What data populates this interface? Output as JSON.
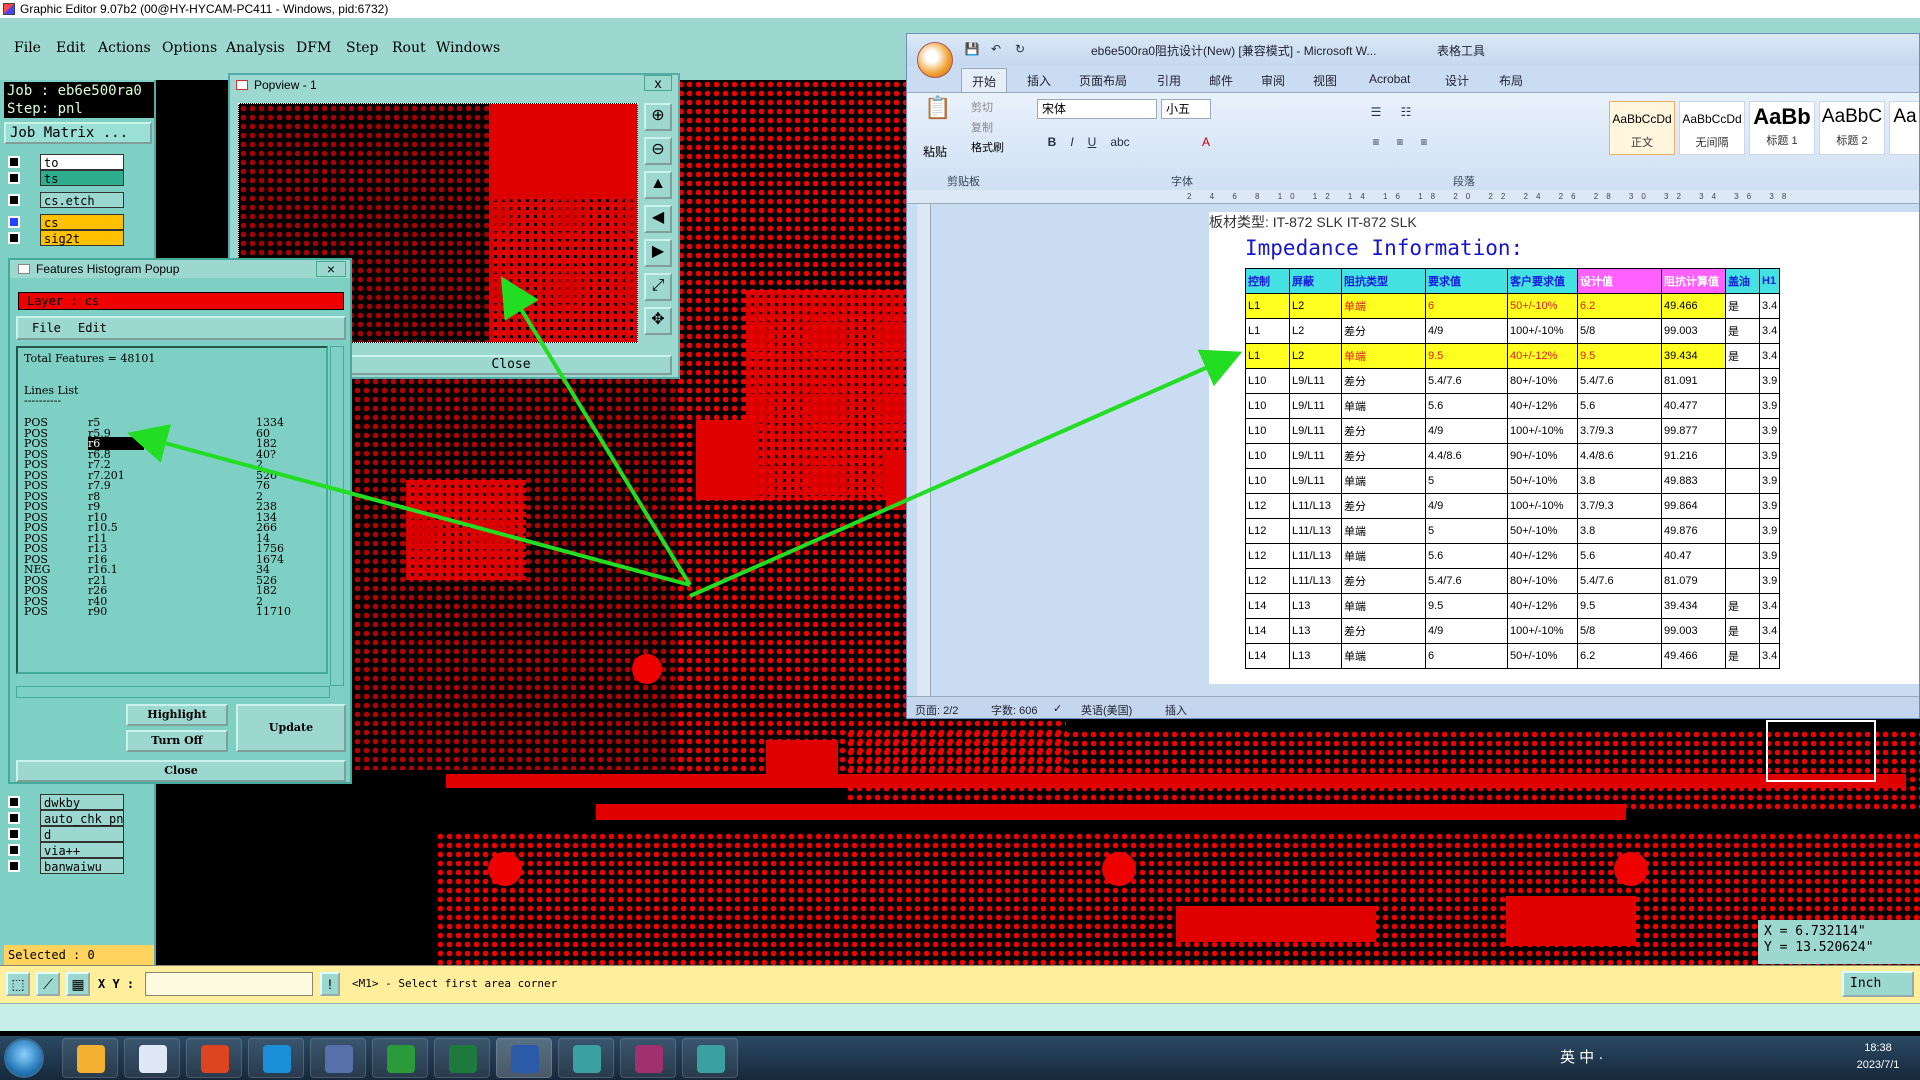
{
  "app_title": "Graphic Editor 9.07b2 (00@HY-HYCAM-PC411 - Windows, pid:6732)",
  "menu": [
    "File",
    "Edit",
    "Actions",
    "Options",
    "Analysis",
    "DFM",
    "Step",
    "Rout",
    "Windows"
  ],
  "left_panel": {
    "job": "Job : eb6e500ra0",
    "step": "Step: pnl",
    "job_matrix": "Job Matrix ...",
    "layers_top": [
      {
        "name": "to",
        "color": "#ffffff"
      },
      {
        "name": "ts",
        "color": "#2eae8e"
      },
      {
        "name": "cs.etch",
        "color": "#9cd8d0"
      },
      {
        "name": "cs",
        "color": "#ffc000"
      },
      {
        "name": "sig2t",
        "color": "#ffc000"
      }
    ],
    "layers_bottom": [
      "dwkby",
      "auto_chk_pn",
      "d",
      "via++",
      "banwaiwu"
    ],
    "selected": "Selected : 0"
  },
  "popview": {
    "title": "Popview - 1",
    "close": "Close",
    "close_x": "x"
  },
  "histogram": {
    "title": "Features Histogram Popup",
    "layer": "Layer : cs",
    "menu_file": "File",
    "menu_edit": "Edit",
    "total": "Total Features = 48101",
    "lines_list": "Lines List",
    "underline": "----------",
    "rows": [
      {
        "pol": "POS",
        "sym": "r5",
        "count": "1334"
      },
      {
        "pol": "POS",
        "sym": "r5.9",
        "count": "60"
      },
      {
        "pol": "POS",
        "sym": "r6",
        "count": "182"
      },
      {
        "pol": "POS",
        "sym": "r6.8",
        "count": "40?"
      },
      {
        "pol": "POS",
        "sym": "r7.2",
        "count": "2"
      },
      {
        "pol": "POS",
        "sym": "r7.201",
        "count": "526"
      },
      {
        "pol": "POS",
        "sym": "r7.9",
        "count": "76"
      },
      {
        "pol": "POS",
        "sym": "r8",
        "count": "2"
      },
      {
        "pol": "POS",
        "sym": "r9",
        "count": "238"
      },
      {
        "pol": "POS",
        "sym": "r10",
        "count": "134"
      },
      {
        "pol": "POS",
        "sym": "r10.5",
        "count": "266"
      },
      {
        "pol": "POS",
        "sym": "r11",
        "count": "14"
      },
      {
        "pol": "POS",
        "sym": "r13",
        "count": "1756"
      },
      {
        "pol": "POS",
        "sym": "r16",
        "count": "1674"
      },
      {
        "pol": "NEG",
        "sym": "r16.1",
        "count": "34"
      },
      {
        "pol": "POS",
        "sym": "r21",
        "count": "526"
      },
      {
        "pol": "POS",
        "sym": "r26",
        "count": "182"
      },
      {
        "pol": "POS",
        "sym": "r40",
        "count": "2"
      },
      {
        "pol": "POS",
        "sym": "r90",
        "count": "11710"
      }
    ],
    "highlighted_row": 2,
    "btn_highlight": "Highlight",
    "btn_turnoff": "Turn Off",
    "btn_update": "Update",
    "btn_close": "Close"
  },
  "word": {
    "title": "eb6e500ra0阻抗设计(New) [兼容模式] - Microsoft W...",
    "table_tools": "表格工具",
    "tabs": [
      "开始",
      "插入",
      "页面布局",
      "引用",
      "邮件",
      "审阅",
      "视图",
      "Acrobat",
      "设计",
      "布局"
    ],
    "clipboard": {
      "paste": "粘贴",
      "cut": "剪切",
      "copy": "复制",
      "format_painter": "格式刷",
      "label": "剪贴板"
    },
    "font": {
      "name": "宋体",
      "size": "小五",
      "label": "字体"
    },
    "paragraph_label": "段落",
    "styles": [
      {
        "preview": "AaBbCcDd",
        "name": "正文"
      },
      {
        "preview": "AaBbCcDd",
        "name": "无间隔"
      },
      {
        "preview": "AaBb",
        "name": "标题 1"
      },
      {
        "preview": "AaBbC",
        "name": "标题 2"
      },
      {
        "preview": "Aa",
        "name": ""
      }
    ],
    "doc_top": "板材类型:    IT-872 SLK         IT-872 SLK",
    "heading": "Impedance Information:",
    "table_headers": [
      "控制",
      "屏蔽",
      "阻抗类型",
      "要求值",
      "客户要求值",
      "设计值",
      "阻抗计算值",
      "盖油",
      "H1"
    ],
    "table_rows": [
      [
        "L1",
        "L2",
        "单端",
        "6",
        "50+/-10%",
        "6.2",
        "49.466",
        "是",
        "3.4"
      ],
      [
        "L1",
        "L2",
        "差分",
        "4/9",
        "100+/-10%",
        "5/8",
        "99.003",
        "是",
        "3.4"
      ],
      [
        "L1",
        "L2",
        "单端",
        "9.5",
        "40+/-12%",
        "9.5",
        "39.434",
        "是",
        "3.4"
      ],
      [
        "L10",
        "L9/L11",
        "差分",
        "5.4/7.6",
        "80+/-10%",
        "5.4/7.6",
        "81.091",
        "",
        "3.9"
      ],
      [
        "L10",
        "L9/L11",
        "单端",
        "5.6",
        "40+/-12%",
        "5.6",
        "40.477",
        "",
        "3.9"
      ],
      [
        "L10",
        "L9/L11",
        "差分",
        "4/9",
        "100+/-10%",
        "3.7/9.3",
        "99.877",
        "",
        "3.9"
      ],
      [
        "L10",
        "L9/L11",
        "差分",
        "4.4/8.6",
        "90+/-10%",
        "4.4/8.6",
        "91.216",
        "",
        "3.9"
      ],
      [
        "L10",
        "L9/L11",
        "单端",
        "5",
        "50+/-10%",
        "3.8",
        "49.883",
        "",
        "3.9"
      ],
      [
        "L12",
        "L11/L13",
        "差分",
        "4/9",
        "100+/-10%",
        "3.7/9.3",
        "99.864",
        "",
        "3.9"
      ],
      [
        "L12",
        "L11/L13",
        "单端",
        "5",
        "50+/-10%",
        "3.8",
        "49.876",
        "",
        "3.9"
      ],
      [
        "L12",
        "L11/L13",
        "单端",
        "5.6",
        "40+/-12%",
        "5.6",
        "40.47",
        "",
        "3.9"
      ],
      [
        "L12",
        "L11/L13",
        "差分",
        "5.4/7.6",
        "80+/-10%",
        "5.4/7.6",
        "81.079",
        "",
        "3.9"
      ],
      [
        "L14",
        "L13",
        "单端",
        "9.5",
        "40+/-12%",
        "9.5",
        "39.434",
        "是",
        "3.4"
      ],
      [
        "L14",
        "L13",
        "差分",
        "4/9",
        "100+/-10%",
        "5/8",
        "99.003",
        "是",
        "3.4"
      ],
      [
        "L14",
        "L13",
        "单端",
        "6",
        "50+/-10%",
        "6.2",
        "49.466",
        "是",
        "3.4"
      ]
    ],
    "highlight_rows": [
      0,
      2
    ],
    "status": {
      "page": "页面: 2/2",
      "words": "字数: 606",
      "lang": "英语(美国)",
      "mode": "插入"
    }
  },
  "coords": {
    "x": "X = 6.732114\"",
    "y": "Y = 13.520624\""
  },
  "cmdbar": {
    "xy_label": "X Y :",
    "prompt": "<M1> - Select first area corner",
    "units": "Inch"
  },
  "taskbar": {
    "time": "18:38",
    "date": "2023/7/1",
    "tray": "英 中 ·"
  },
  "colors": {
    "copper": "#e00000",
    "panel": "#9cd8d0",
    "arrow": "#22dd22"
  }
}
